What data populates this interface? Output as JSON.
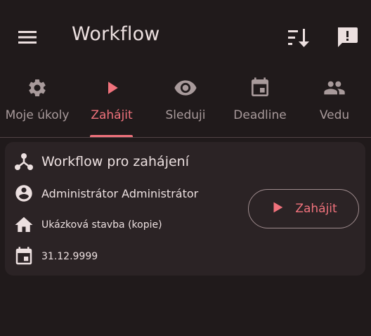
{
  "appbar": {
    "title": "Workflow",
    "menu_icon": "hamburger-menu-icon",
    "sort_icon": "sort-descending-icon",
    "feedback_icon": "feedback-exclamation-icon"
  },
  "tabs": [
    {
      "label": "Moje úkoly",
      "icon": "gear-icon",
      "active": false
    },
    {
      "label": "Zahájit",
      "icon": "play-icon",
      "active": true
    },
    {
      "label": "Sleduji",
      "icon": "eye-icon",
      "active": false
    },
    {
      "label": "Deadline",
      "icon": "calendar-icon",
      "active": false
    },
    {
      "label": "Vedu",
      "icon": "people-icon",
      "active": false
    }
  ],
  "card": {
    "workflow_name": "Workflow pro zahájení",
    "user": "Administrátor Administrátor",
    "project": "Ukázková stavba (kopie)",
    "date": "31.12.9999",
    "start_button": "Zahájit"
  },
  "colors": {
    "background": "#201a1b",
    "card": "#2b2325",
    "accent": "#f0727c",
    "text": "#ece0e0",
    "inactive": "#a89a9b"
  }
}
